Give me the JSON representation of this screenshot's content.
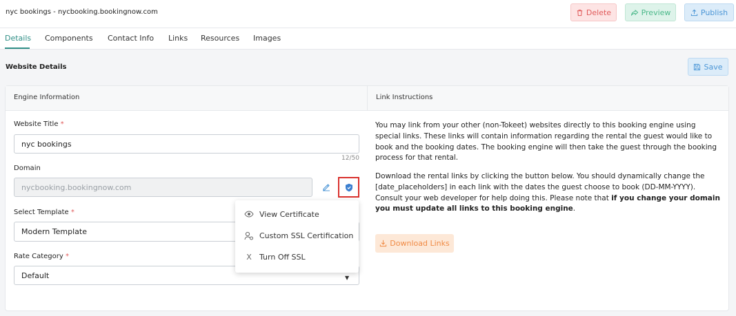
{
  "header": {
    "title": "nyc bookings - nycbooking.bookingnow.com",
    "delete_label": "Delete",
    "preview_label": "Preview",
    "publish_label": "Publish"
  },
  "tabs": [
    {
      "label": "Details",
      "active": true
    },
    {
      "label": "Components"
    },
    {
      "label": "Contact Info"
    },
    {
      "label": "Links"
    },
    {
      "label": "Resources"
    },
    {
      "label": "Images"
    }
  ],
  "section": {
    "title": "Website Details",
    "save_label": "Save"
  },
  "card": {
    "left_header": "Engine Information",
    "right_header": "Link Instructions"
  },
  "form": {
    "website_title": {
      "label": "Website Title",
      "required": "*",
      "value": "nyc bookings",
      "counter": "12/50"
    },
    "domain": {
      "label": "Domain",
      "value": "nycbooking.bookingnow.com"
    },
    "template": {
      "label": "Select Template",
      "required": "*",
      "value": "Modern Template"
    },
    "rate_category": {
      "label": "Rate Category",
      "required": "*",
      "value": "Default"
    }
  },
  "ssl_menu": {
    "items": [
      {
        "label": "View Certificate",
        "icon": "eye-icon"
      },
      {
        "label": "Custom SSL Certification",
        "icon": "user-cert-icon"
      },
      {
        "label": "Turn Off SSL",
        "icon": "x-icon"
      }
    ]
  },
  "instructions": {
    "paragraph1": "You may link from your other (non-Tokeet) websites directly to this booking engine using special links. These links will contain information regarding the rental the guest would like to book and the booking dates. The booking engine will then take the guest through the booking process for that rental.",
    "paragraph2_start": "Download the rental links by clicking the button below. You should dynamically change the [date_placeholders] in each link with the dates the guest choose to book (DD-MM-YYYY). Consult your web developer for help doing this. Please note that ",
    "paragraph2_bold": "if you change your domain you must update all links to this booking engine",
    "paragraph2_end": ".",
    "download_label": "Download Links"
  },
  "colors": {
    "accent": "#2f8f86",
    "danger": "#e05a5a",
    "success": "#4bb88a",
    "info": "#4c96d6",
    "warning": "#f08a44",
    "highlight_border": "#d9302c"
  }
}
